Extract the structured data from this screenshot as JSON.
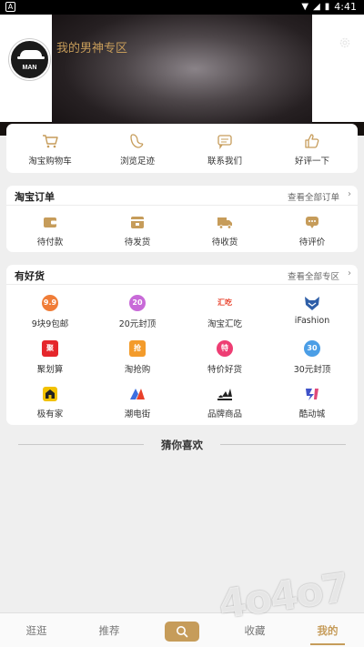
{
  "status_bar": {
    "time": "4:41"
  },
  "profile": {
    "title": "我的男神专区",
    "avatar_text": "MAN"
  },
  "quick_actions": [
    {
      "label": "淘宝购物车",
      "icon": "cart-icon"
    },
    {
      "label": "浏览足迹",
      "icon": "footprint-icon"
    },
    {
      "label": "联系我们",
      "icon": "chat-icon"
    },
    {
      "label": "好评一下",
      "icon": "thumbs-up-icon"
    }
  ],
  "orders": {
    "title": "淘宝订单",
    "view_all": "查看全部订单",
    "items": [
      {
        "label": "待付款",
        "icon": "wallet-icon"
      },
      {
        "label": "待发货",
        "icon": "package-icon"
      },
      {
        "label": "待收货",
        "icon": "truck-icon"
      },
      {
        "label": "待评价",
        "icon": "comment-icon"
      }
    ]
  },
  "good_stuff": {
    "title": "有好货",
    "view_all": "查看全部专区",
    "items": [
      {
        "label": "9块9包邮",
        "badge": "9.9",
        "color": "#f07d38"
      },
      {
        "label": "20元封顶",
        "badge": "20",
        "color": "#c86ad8"
      },
      {
        "label": "淘宝汇吃",
        "badge": "汇吃",
        "color": "#e8402a"
      },
      {
        "label": "iFashion",
        "badge": "",
        "color": "#2f5fa8"
      },
      {
        "label": "聚划算",
        "badge": "聚",
        "color": "#e5262b"
      },
      {
        "label": "淘抢购",
        "badge": "抢",
        "color": "#f39b2b"
      },
      {
        "label": "特价好货",
        "badge": "特",
        "color": "#ee3d73"
      },
      {
        "label": "30元封顶",
        "badge": "30",
        "color": "#4b9ee6"
      },
      {
        "label": "极有家",
        "badge": "",
        "color": "#f2c100"
      },
      {
        "label": "潮电街",
        "badge": "",
        "color": "#3d6fe0"
      },
      {
        "label": "品牌商品",
        "badge": "",
        "color": "#222222"
      },
      {
        "label": "酷动城",
        "badge": "",
        "color": "#3f52c9"
      }
    ]
  },
  "guess_you_like": "猜你喜欢",
  "tabs": {
    "stroll": "逛逛",
    "recommend": "推荐",
    "favorites": "收藏",
    "mine": "我的"
  },
  "watermark": "4o4o7",
  "colors": {
    "accent": "#c69c5a",
    "background": "#efefef",
    "card": "#ffffff"
  }
}
